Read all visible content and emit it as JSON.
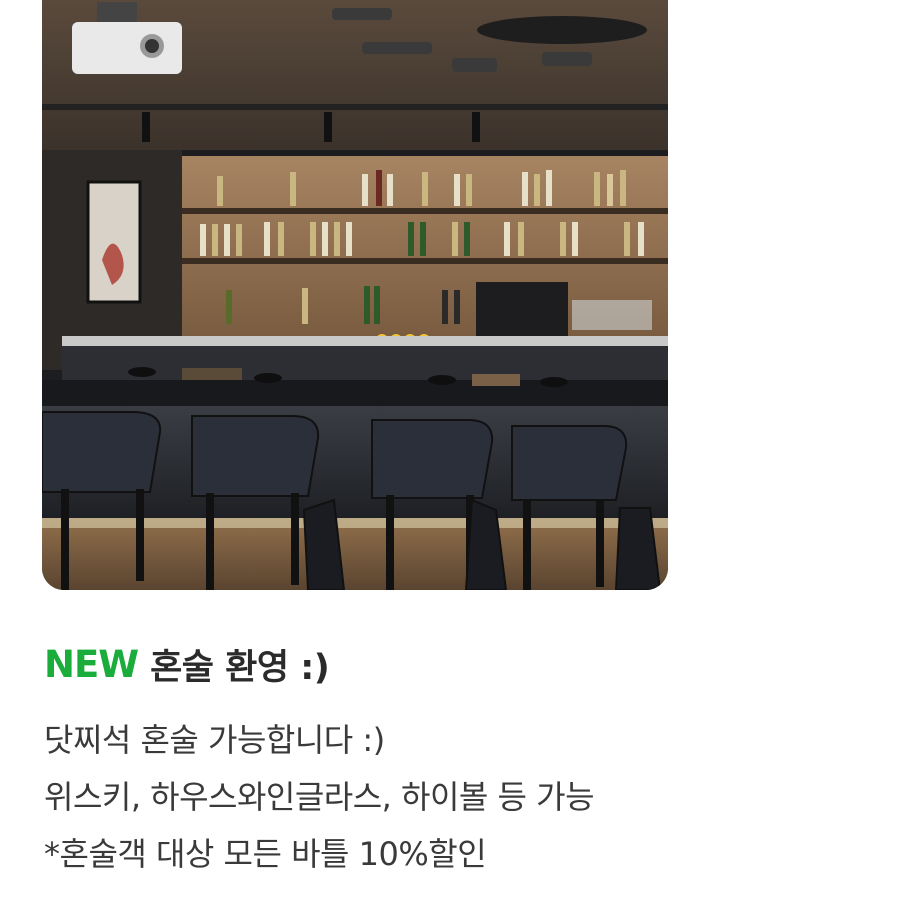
{
  "post": {
    "image": {
      "alt_semantic": "bar-interior-photo",
      "colors": {
        "wood_panel": "#8a6a4c",
        "dark_wall": "#2a2826",
        "counter": "#202226",
        "chair": "#2b2f3a",
        "floor": "#6b5136",
        "light_glow": "#f3d9a8"
      }
    },
    "title": {
      "badge": "NEW",
      "badge_color": "#1aad3b",
      "text": "혼술 환영 :)"
    },
    "lines": [
      "닷찌석 혼술 가능합니다 :)",
      "위스키, 하우스와인글라스, 하이볼 등 가능",
      "*혼술객 대상 모든 바틀 10%할인"
    ]
  }
}
